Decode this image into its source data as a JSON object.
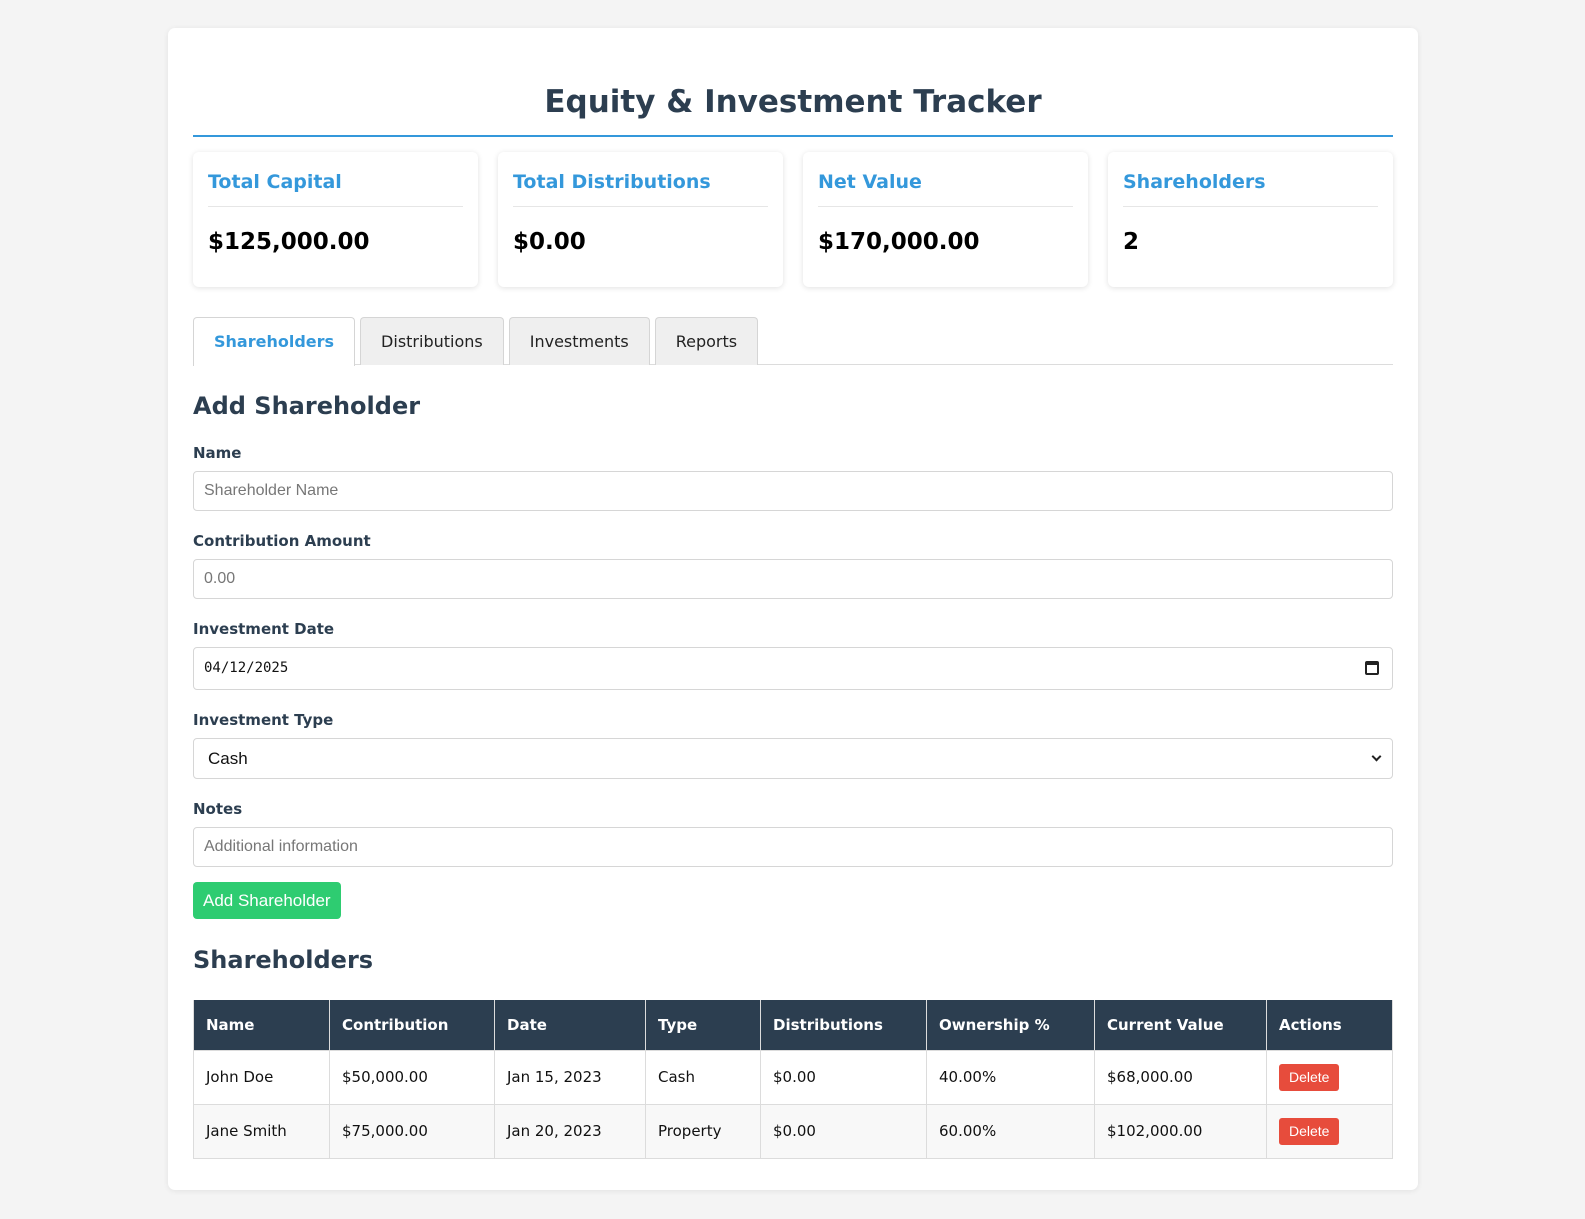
{
  "header": {
    "title": "Equity & Investment Tracker"
  },
  "summary": {
    "cards": [
      {
        "label": "Total Capital",
        "value": "$125,000.00"
      },
      {
        "label": "Total Distributions",
        "value": "$0.00"
      },
      {
        "label": "Net Value",
        "value": "$170,000.00"
      },
      {
        "label": "Shareholders",
        "value": "2"
      }
    ]
  },
  "tabs": {
    "items": [
      {
        "label": "Shareholders",
        "active": true
      },
      {
        "label": "Distributions",
        "active": false
      },
      {
        "label": "Investments",
        "active": false
      },
      {
        "label": "Reports",
        "active": false
      }
    ]
  },
  "form": {
    "heading": "Add Shareholder",
    "name": {
      "label": "Name",
      "placeholder": "Shareholder Name",
      "value": ""
    },
    "contribution": {
      "label": "Contribution Amount",
      "placeholder": "0.00",
      "value": ""
    },
    "date": {
      "label": "Investment Date",
      "value": "04/12/2025"
    },
    "type": {
      "label": "Investment Type",
      "selected": "Cash"
    },
    "notes": {
      "label": "Notes",
      "placeholder": "Additional information",
      "value": ""
    },
    "submit_label": "Add Shareholder"
  },
  "table": {
    "heading": "Shareholders",
    "columns": [
      "Name",
      "Contribution",
      "Date",
      "Type",
      "Distributions",
      "Ownership %",
      "Current Value",
      "Actions"
    ],
    "rows": [
      {
        "name": "John Doe",
        "contribution": "$50,000.00",
        "date": "Jan 15, 2023",
        "type": "Cash",
        "distributions": "$0.00",
        "ownership": "40.00%",
        "current_value": "$68,000.00",
        "action_label": "Delete"
      },
      {
        "name": "Jane Smith",
        "contribution": "$75,000.00",
        "date": "Jan 20, 2023",
        "type": "Property",
        "distributions": "$0.00",
        "ownership": "60.00%",
        "current_value": "$102,000.00",
        "action_label": "Delete"
      }
    ]
  },
  "colors": {
    "accent": "#3498db",
    "header_dark": "#2c3e50",
    "success": "#2ecc71",
    "danger": "#e74c3c"
  },
  "icons": {
    "date_picker": "calendar-icon",
    "select": "chevron-down-icon"
  }
}
